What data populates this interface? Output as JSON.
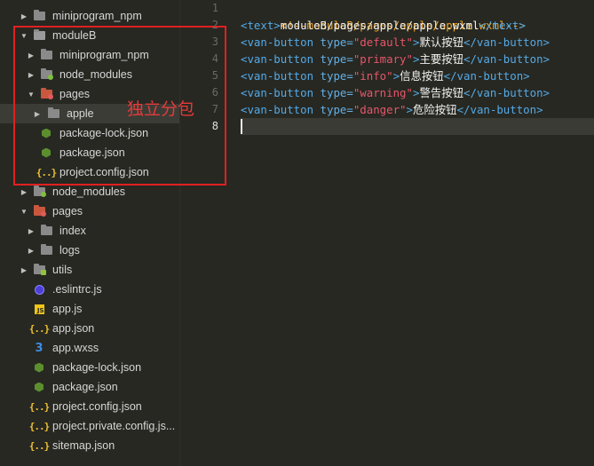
{
  "sidebar": {
    "items": [
      {
        "label": "miniprogram_npm",
        "indent": 0,
        "expanded": false,
        "icon": "folder-icon"
      },
      {
        "label": "moduleB",
        "indent": 0,
        "expanded": true,
        "icon": "folder-open-icon"
      },
      {
        "label": "miniprogram_npm",
        "indent": 1,
        "expanded": false,
        "icon": "folder-icon"
      },
      {
        "label": "node_modules",
        "indent": 1,
        "expanded": false,
        "icon": "folder-node-icon"
      },
      {
        "label": "pages",
        "indent": 1,
        "expanded": true,
        "icon": "folder-pages-icon"
      },
      {
        "label": "apple",
        "indent": 2,
        "expanded": false,
        "icon": "folder-icon"
      },
      {
        "label": "package-lock.json",
        "indent": 1,
        "icon": "node-file-icon"
      },
      {
        "label": "package.json",
        "indent": 1,
        "icon": "node-file-icon"
      },
      {
        "label": "project.config.json",
        "indent": 1,
        "icon": "json-file-icon"
      },
      {
        "label": "node_modules",
        "indent": 0,
        "expanded": false,
        "icon": "folder-node-icon"
      },
      {
        "label": "pages",
        "indent": 0,
        "expanded": true,
        "icon": "folder-pages-icon"
      },
      {
        "label": "index",
        "indent": 1,
        "expanded": false,
        "icon": "folder-icon"
      },
      {
        "label": "logs",
        "indent": 1,
        "expanded": false,
        "icon": "folder-icon"
      },
      {
        "label": "utils",
        "indent": 0,
        "expanded": false,
        "icon": "folder-utils-icon"
      },
      {
        "label": ".eslintrc.js",
        "indent": 0,
        "icon": "eslint-file-icon"
      },
      {
        "label": "app.js",
        "indent": 0,
        "icon": "js-file-icon"
      },
      {
        "label": "app.json",
        "indent": 0,
        "icon": "json-file-icon"
      },
      {
        "label": "app.wxss",
        "indent": 0,
        "icon": "css-file-icon"
      },
      {
        "label": "package-lock.json",
        "indent": 0,
        "icon": "node-file-icon"
      },
      {
        "label": "package.json",
        "indent": 0,
        "icon": "node-file-icon"
      },
      {
        "label": "project.config.json",
        "indent": 0,
        "icon": "json-file-icon"
      },
      {
        "label": "project.private.config.js...",
        "indent": 0,
        "icon": "json-file-icon"
      },
      {
        "label": "sitemap.json",
        "indent": 0,
        "icon": "json-file-icon"
      }
    ],
    "selected_index": 5,
    "annotation": "独立分包"
  },
  "editor": {
    "line_numbers": [
      "1",
      "2",
      "3",
      "4",
      "5",
      "6",
      "7",
      "8"
    ],
    "active_line": 8,
    "lines": [
      {
        "comment": "<!--moduleB/pages/apple/apple.wxml-->"
      },
      {
        "open": "<text>",
        "text": "moduleB/pages/apple/apple.wxml",
        "close": "</text>"
      },
      {
        "tag": "<van-button ",
        "attr": "type=",
        "value": "\"default\"",
        "gt": ">",
        "text": "默认按钮",
        "close": "</van-button>"
      },
      {
        "tag": "<van-button ",
        "attr": "type=",
        "value": "\"primary\"",
        "gt": ">",
        "text": "主要按钮",
        "close": "</van-button>"
      },
      {
        "tag": "<van-button ",
        "attr": "type=",
        "value": "\"info\"",
        "gt": ">",
        "text": "信息按钮",
        "close": "</van-button>"
      },
      {
        "tag": "<van-button ",
        "attr": "type=",
        "value": "\"warning\"",
        "gt": ">",
        "text": "警告按钮",
        "close": "</van-button>"
      },
      {
        "tag": "<van-button ",
        "attr": "type=",
        "value": "\"danger\"",
        "gt": ">",
        "text": "危险按钮",
        "close": "</van-button>"
      }
    ]
  },
  "colors": {
    "background": "#272822",
    "annotation": "#e53a3a",
    "tag": "#54a9e6",
    "string": "#e6566a",
    "comment": "#f2a520"
  }
}
